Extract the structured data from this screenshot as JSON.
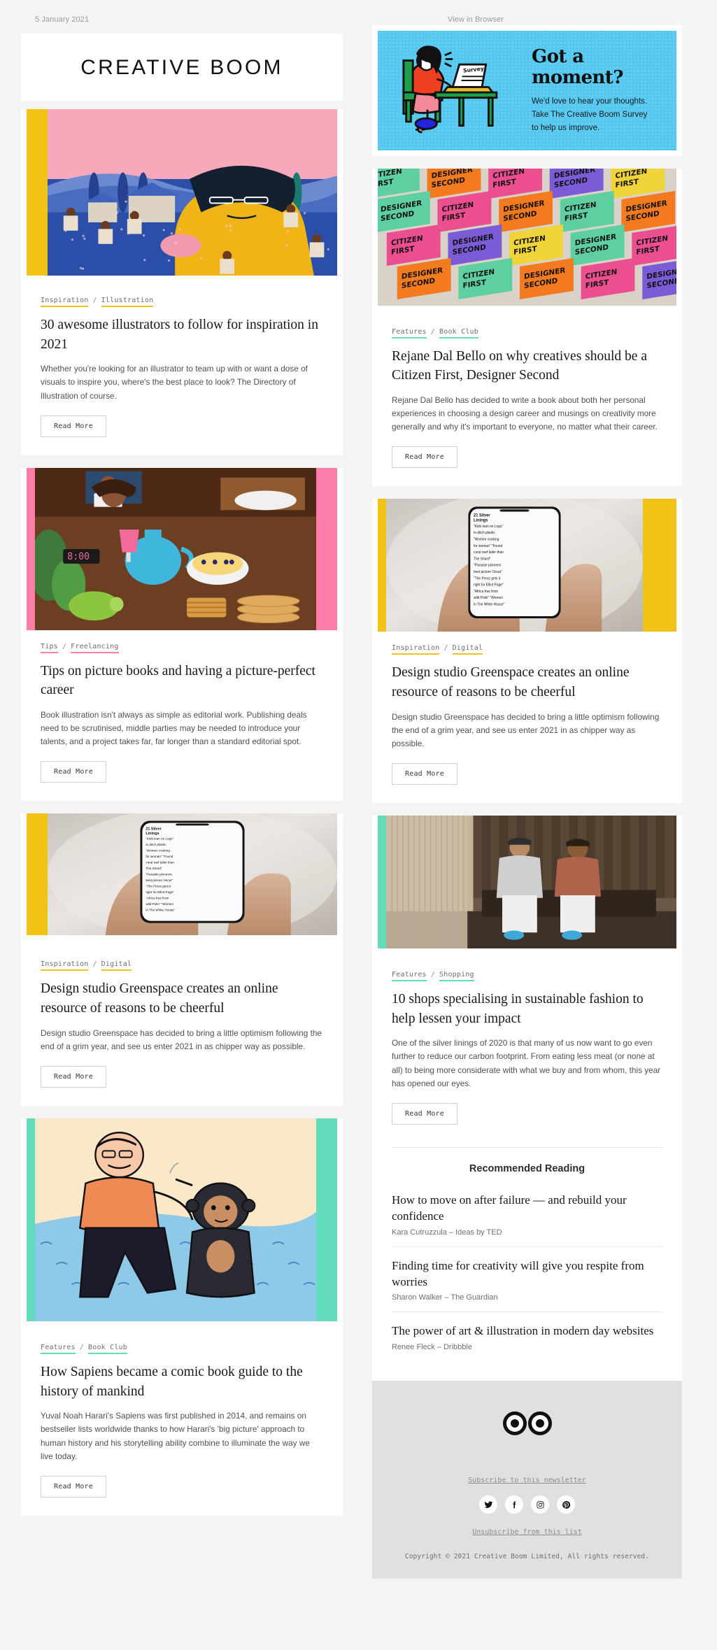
{
  "preheader": {
    "date": "5 January 2021",
    "view_in_browser": "View in Browser"
  },
  "masthead": {
    "logo": "CREATIVE BOOM"
  },
  "survey": {
    "heading": "Got a moment?",
    "line1": "We'd love to hear your thoughts.",
    "line2": "Take The Creative Boom Survey",
    "line3": "to help us improve.",
    "laptop_label": "Survey",
    "bg_color": "#55c8f0"
  },
  "read_more_label": "Read More",
  "accents": {
    "yellow": "#f2c317",
    "teal": "#63dcbc",
    "pink": "#fd7daa"
  },
  "left_articles": [
    {
      "tag1": "Inspiration",
      "tag2": "Illustration",
      "tag_color": "yellow",
      "accent": "#f2c317",
      "title": "30 awesome illustrators to follow for inspiration in 2021",
      "excerpt": "Whether you're looking for an illustrator to team up with or want a dose of visuals to inspire you, where's the best place to look? The Directory of Illustration of course.",
      "image": "village-illustration"
    },
    {
      "tag1": "Tips",
      "tag2": "Freelancing",
      "tag_color": "pink",
      "accent": "#fd7daa",
      "title": "Tips on picture books and having a picture-perfect career",
      "excerpt": "Book illustration isn't always as simple as editorial work. Publishing deals need to be scrutinised, middle parties may be needed to introduce your talents, and a project takes far, far longer than a standard editorial spot.",
      "image": "breakfast-table-illustration"
    },
    {
      "tag1": "Inspiration",
      "tag2": "Digital",
      "tag_color": "yellow",
      "accent": "#f2c317",
      "title": "Design studio Greenspace creates an online resource of reasons to be cheerful",
      "excerpt": "Design studio Greenspace has decided to bring a little optimism following the end of a grim year, and see us enter 2021 in as chipper way as possible.",
      "image": "hand-holding-phone-photo"
    },
    {
      "tag1": "Features",
      "tag2": "Book Club",
      "tag_color": "teal",
      "accent": "#63dcbc",
      "title": "How Sapiens became a comic book guide to the history of mankind",
      "excerpt": "Yuval Noah Harari's Sapiens was first published in 2014, and remains on bestseller lists worldwide thanks to how Harari's 'big picture' approach to human history and his storytelling ability combine to illuminate the way we live today.",
      "image": "man-and-monkey-illustration"
    }
  ],
  "right_articles": [
    {
      "tag1": "Features",
      "tag2": "Book Club",
      "tag_color": "teal",
      "accent": "#63dcbc",
      "title": "Rejane Dal Bello on why creatives should be a Citizen First, Designer Second",
      "excerpt": "Rejane Dal Bello has decided to write a book about both her personal experiences in choosing a design career and musings on creativity more generally and why it's important to everyone, no matter what their career.",
      "image": "citizen-first-books-photo",
      "book_label_1": "CITIZEN FIRST",
      "book_label_2": "DESIGNER SECOND"
    },
    {
      "tag1": "Inspiration",
      "tag2": "Digital",
      "tag_color": "yellow",
      "accent": "#f2c317",
      "title": "Design studio Greenspace creates an online resource of reasons to be cheerful",
      "excerpt": "Design studio Greenspace has decided to bring a little optimism following the end of a grim year, and see us enter 2021 in as chipper way as possible.",
      "image": "hand-holding-phone-photo"
    },
    {
      "tag1": "Features",
      "tag2": "Shopping",
      "tag_color": "teal",
      "accent": "#63dcbc",
      "title": "10 shops specialising in sustainable fashion to help lessen your impact",
      "excerpt": "One of the silver linings of 2020 is that many of us now want to go even further to reduce our carbon footprint. From eating less meat (or none at all) to being more considerate with what we buy and from whom, this year has opened our eyes.",
      "image": "two-men-seated-photo"
    }
  ],
  "recommended": {
    "heading": "Recommended Reading",
    "items": [
      {
        "title": "How to move on after failure — and rebuild your confidence",
        "meta": "Kara Cutruzzula – Ideas by TED"
      },
      {
        "title": "Finding time for creativity will give you respite from worries",
        "meta": "Sharon Walker – The Guardian"
      },
      {
        "title": "The power of art & illustration in modern day websites",
        "meta": "Renee Fleck – Dribbble"
      }
    ]
  },
  "footer": {
    "subscribe": "Subscribe to this newsletter",
    "unsubscribe": "Unsubscribe from this list",
    "copyright": "Copyright © 2021 Creative Boom Limited, All rights reserved.",
    "socials": [
      "twitter-icon",
      "facebook-icon",
      "instagram-icon",
      "pinterest-icon"
    ]
  },
  "phone_photo": {
    "headline": "21 Silver Linings",
    "lines": [
      "\"Kids lean on Lego\"",
      "to ditch plastic",
      "\"Women cooking",
      "for woman\" \"Found",
      "coral reef taller than",
      "The Shard\"",
      "\"Parasite pioneers",
      "best picture Oscar\"",
      "\"The Press gets it",
      "right for Elliot Page\"",
      "\"Africa free from",
      "wild Polio\" \"Women",
      "in The White House\""
    ]
  }
}
